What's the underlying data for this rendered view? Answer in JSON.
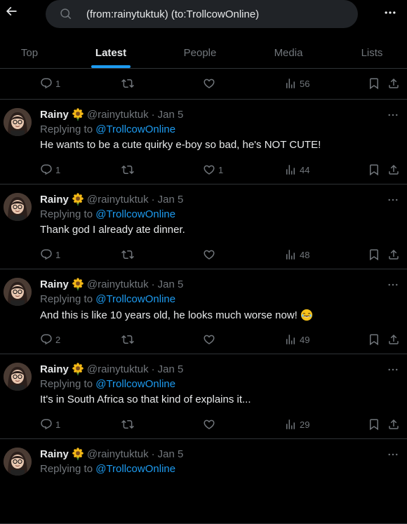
{
  "search": {
    "query": "(from:rainytuktuk) (to:TrollcowOnline)"
  },
  "tabs": [
    {
      "label": "Top",
      "active": false
    },
    {
      "label": "Latest",
      "active": true
    },
    {
      "label": "People",
      "active": false
    },
    {
      "label": "Media",
      "active": false
    },
    {
      "label": "Lists",
      "active": false
    }
  ],
  "first_actions": {
    "replies": "1",
    "retweets": "",
    "likes": "",
    "views": "56"
  },
  "tweets": [
    {
      "name": "Rainy",
      "handle": "@rainytuktuk",
      "date": "Jan 5",
      "replying_prefix": "Replying to",
      "replying_to": "@TrollcowOnline",
      "text": "He wants to be a cute quirky e-boy so bad, he's NOT CUTE!",
      "emoji": "",
      "replies": "1",
      "retweets": "",
      "likes": "1",
      "views": "44"
    },
    {
      "name": "Rainy",
      "handle": "@rainytuktuk",
      "date": "Jan 5",
      "replying_prefix": "Replying to",
      "replying_to": "@TrollcowOnline",
      "text": "Thank god I already ate dinner.",
      "emoji": "",
      "replies": "1",
      "retweets": "",
      "likes": "",
      "views": "48"
    },
    {
      "name": "Rainy",
      "handle": "@rainytuktuk",
      "date": "Jan 5",
      "replying_prefix": "Replying to",
      "replying_to": "@TrollcowOnline",
      "text": "And this is like 10 years old, he looks much worse now!",
      "emoji": "laughing-tears-emoji",
      "replies": "2",
      "retweets": "",
      "likes": "",
      "views": "49"
    },
    {
      "name": "Rainy",
      "handle": "@rainytuktuk",
      "date": "Jan 5",
      "replying_prefix": "Replying to",
      "replying_to": "@TrollcowOnline",
      "text": "It's in South Africa so that kind of explains it...",
      "emoji": "",
      "replies": "1",
      "retweets": "",
      "likes": "",
      "views": "29"
    },
    {
      "name": "Rainy",
      "handle": "@rainytuktuk",
      "date": "Jan 5",
      "replying_prefix": "Replying to",
      "replying_to": "@TrollcowOnline",
      "text": "",
      "emoji": "",
      "replies": "",
      "retweets": "",
      "likes": "",
      "views": ""
    }
  ],
  "colors": {
    "accent": "#1d9bf0",
    "muted": "#71767b",
    "text": "#e7e9ea",
    "background": "#000000",
    "border": "#2f3336"
  },
  "icons": {
    "back": "arrow-left-icon",
    "search": "search-icon",
    "more": "more-horizontal-icon",
    "reply": "reply-icon",
    "retweet": "retweet-icon",
    "like": "heart-icon",
    "views": "views-icon",
    "bookmark": "bookmark-icon",
    "share": "share-icon",
    "verified_flower": "sunflower-emoji"
  }
}
